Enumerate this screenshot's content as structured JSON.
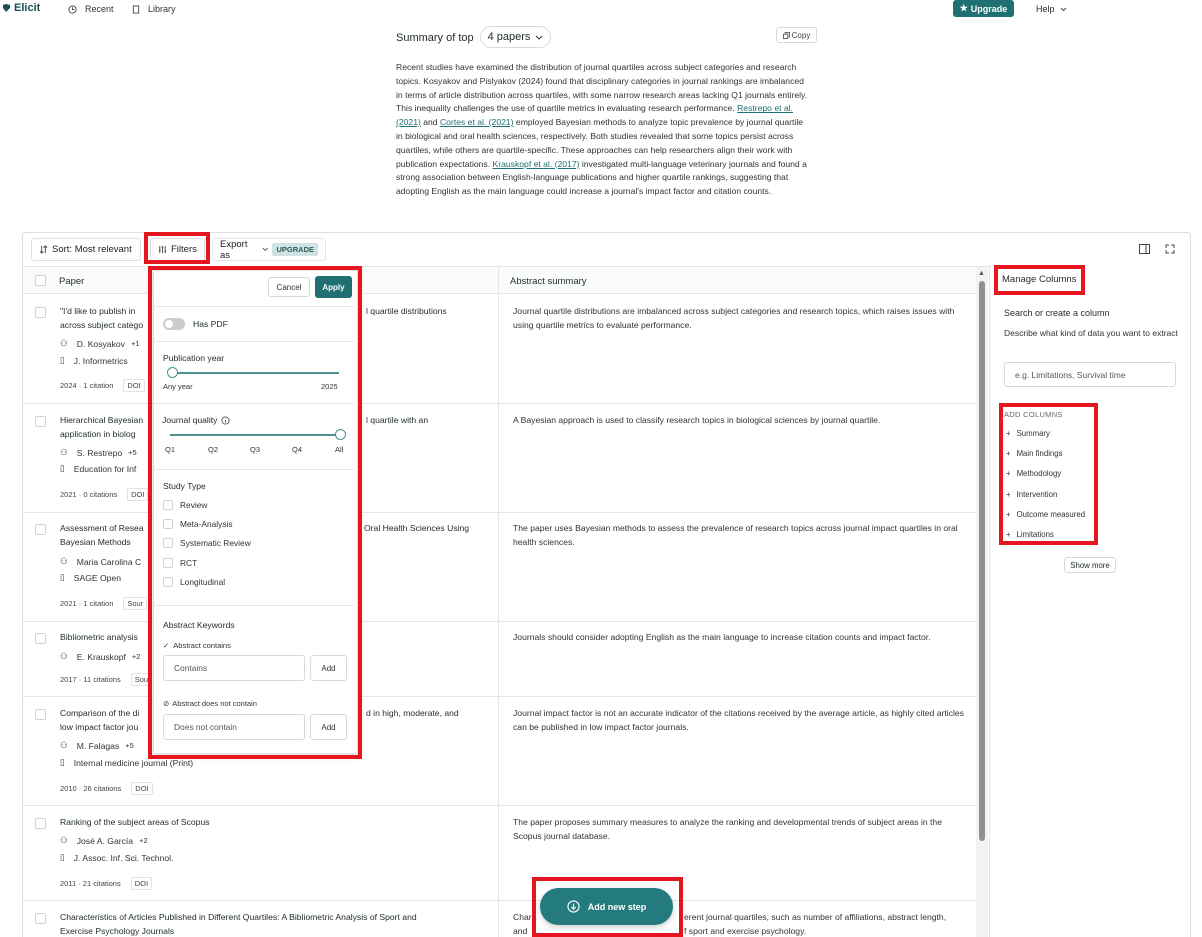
{
  "nav": {
    "brand": "Elicit",
    "recent": "Recent",
    "library": "Library",
    "upgrade": "Upgrade",
    "help": "Help"
  },
  "summary": {
    "title": "Summary of top",
    "papers_dropdown": "4 papers",
    "copy": "Copy",
    "p1": "Recent studies have examined the distribution of journal quartiles across subject categories and research topics. Kosyakov and Pislyakov (2024) found that disciplinary categories in journal rankings are imbalanced in terms of article distribution across quartiles, with some narrow research areas lacking Q1 journals entirely. This inequality challenges the use of quartile metrics in evaluating research performance.",
    "link1": "Restrepo et al. (2021)",
    "and": "and",
    "link2": "Cortes et al. (2021)",
    "p2": "employed Bayesian methods to analyze topic prevalence by journal quartile in biological and oral health sciences, respectively. Both studies revealed that some topics persist across quartiles, while others are quartile-specific. These approaches can help researchers align their work with publication expectations.",
    "link3": "Krauskopf et al. (2017)",
    "p3": "investigated multi-language veterinary journals and found a strong association between English-language publications and higher quartile rankings, suggesting that adopting English as the main language could increase a journal's impact factor and citation counts."
  },
  "toolbar": {
    "sort": "Sort: Most relevant",
    "filters": "Filters",
    "export": "Export as",
    "upgrade_badge": "UPGRADE"
  },
  "table": {
    "col_paper": "Paper",
    "col_abstract": "Abstract summary",
    "rows": [
      {
        "t1": "\"I'd like to publish in",
        "t1r": "l quartile distributions",
        "t2": "across subject catego",
        "author": "D. Kosyakov",
        "more": "+1",
        "venue": "J. Informetrics",
        "meta": "2024 · 1 citation",
        "chip": "DOI",
        "summary": "Journal quartile distributions are imbalanced across subject categories and research topics, which raises issues with using quartile metrics to evaluate performance."
      },
      {
        "t1": "Hierarchical Bayesian",
        "t1r": "l quartile with an",
        "t2": "application in biolog",
        "author": "S. Restrepo",
        "more": "+5",
        "venue": "Education for Inf",
        "meta": "2021 · 0 citations",
        "chip": "DOI",
        "summary": "A Bayesian approach is used to classify research topics in biological sciences by journal quartile."
      },
      {
        "t1": "Assessment of Resea",
        "t1r": "Oral Health Sciences Using",
        "t2": "Bayesian Methods",
        "author": "Maria Carolina C",
        "more": "",
        "venue": "SAGE Open",
        "meta": "2021 · 1 citation",
        "chip": "Sour",
        "summary": "The paper uses Bayesian methods to assess the prevalence of research topics across journal impact quartiles in oral health sciences."
      },
      {
        "t1": "Bibliometric analysis",
        "t1r": "",
        "t2": "",
        "author": "E. Krauskopf",
        "more": "+2",
        "venue": "",
        "meta": "2017 · 11 citations",
        "chip": "Sou",
        "summary": "Journals should consider adopting English as the main language to increase citation counts and impact factor."
      },
      {
        "t1": "Comparison of the di",
        "t1r": "d in high, moderate, and",
        "t2": "low impact factor jou",
        "author": "M. Falagas",
        "more": "+5",
        "venue": "Internal medicine journal (Print)",
        "meta": "2010 · 26 citations",
        "chip": "DOI",
        "summary": "Journal impact factor is not an accurate indicator of the citations received by the average article, as highly cited articles can be published in low impact factor journals."
      },
      {
        "t1": "Ranking of the subject areas of Scopus",
        "t1r": "",
        "t2": "",
        "author": "José A. García",
        "more": "+2",
        "venue": "J. Assoc. Inf. Sci. Technol.",
        "meta": "2011 · 21 citations",
        "chip": "DOI",
        "summary": "The paper proposes summary measures to analyze the ranking and developmental trends of subject areas in the Scopus journal database."
      },
      {
        "t1": "Characteristics of Articles Published in Different Quartiles: A Bibliometric Analysis of Sport and",
        "t1r": "",
        "t2": "Exercise Psychology Journals",
        "author": "",
        "more": "",
        "venue": "",
        "meta": "",
        "chip": "",
        "summary_a": "Chara",
        "summary_b": "erent journal quartiles, such as number of affiliations, abstract length,",
        "summary_c": "and",
        "summary_d": "f sport and exercise psychology."
      }
    ]
  },
  "filters": {
    "cancel": "Cancel",
    "apply": "Apply",
    "has_pdf": "Has PDF",
    "pub_year": "Publication year",
    "any_year": "Any year",
    "year_max": "2025",
    "journal_quality": "Journal quality",
    "quartiles": [
      "Q1",
      "Q2",
      "Q3",
      "Q4",
      "All"
    ],
    "study_type": "Study Type",
    "study_options": [
      "Review",
      "Meta-Analysis",
      "Systematic Review",
      "RCT",
      "Longitudinal"
    ],
    "abstract_keywords": "Abstract Keywords",
    "abstract_contains": "Abstract contains",
    "contains_ph": "Contains",
    "add": "Add",
    "abstract_not_contains": "Abstract does not contain",
    "not_contains_ph": "Does not contain"
  },
  "columns_panel": {
    "title": "Manage Columns",
    "search_title": "Search or create a column",
    "search_desc": "Describe what kind of data you want to extract",
    "input_ph": "e.g. Limitations, Survival time",
    "add_columns": "ADD COLUMNS",
    "items": [
      "Summary",
      "Main findings",
      "Methodology",
      "Intervention",
      "Outcome measured",
      "Limitations"
    ],
    "show_more": "Show more"
  },
  "add_step": "Add new step",
  "colors": {
    "accent": "#1f6f73",
    "highlight": "#e5161f"
  }
}
